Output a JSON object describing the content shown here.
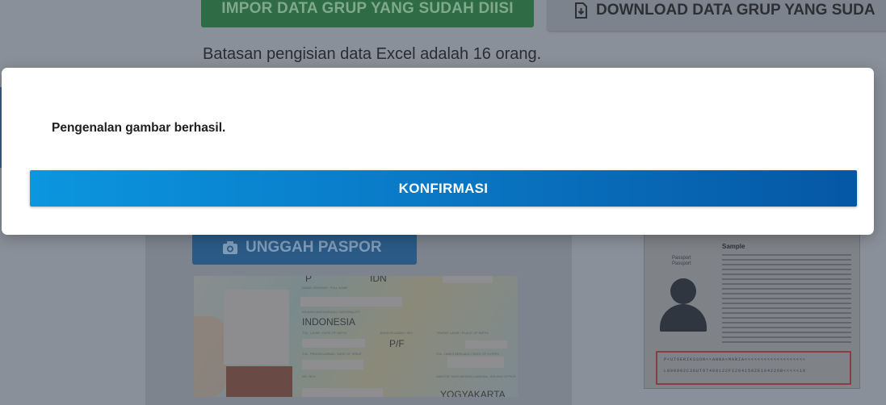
{
  "background": {
    "impor_button": "IMPOR DATA GRUP YANG SUDAH DIISI",
    "download_button": "DOWNLOAD DATA GRUP YANG SUDA",
    "limit_text": "Batasan pengisian data Excel adalah 16 orang.",
    "unggah_button": "UNGGAH PASPOR",
    "passport_scan": {
      "type_value": "P",
      "country_value": "IDN",
      "name_label": "NAMA LENGKAP / FULL NAME",
      "nationality_label": "KEWARGANEGARAAN / NATIONALITY",
      "nationality_value": "INDONESIA",
      "dob_label": "TGL. LAHIR / DATE OF BIRTH",
      "sex_label": "JENIS KELAMIN / SEX",
      "pob_label": "TEMPAT LAHIR / PLACE OF BIRTH",
      "sex_value": "P/F",
      "issue_label": "TGL. PENGELUARAN / DATE OF ISSUE",
      "expiry_label": "TGL. HABIS BERLAKU / DATE OF EXPIRY",
      "office_label": "KANTOR YANG MENGELUARKAN / ISSUING OFFICE",
      "reg_label": "NO. REG",
      "office_value": "YOGYAKARTA"
    },
    "sample_passport": {
      "title": "Sample",
      "passport_label": "Passport",
      "passport_label_en": "Passport"
    }
  },
  "modal": {
    "message": "Pengenalan gambar berhasil.",
    "confirm_button": "KONFIRMASI"
  },
  "colors": {
    "confirm_gradient_start": "#0b96de",
    "confirm_gradient_end": "#0557a4",
    "overlay": "#8a9099"
  },
  "icons": {
    "download": "download-icon",
    "camera": "camera-icon"
  }
}
